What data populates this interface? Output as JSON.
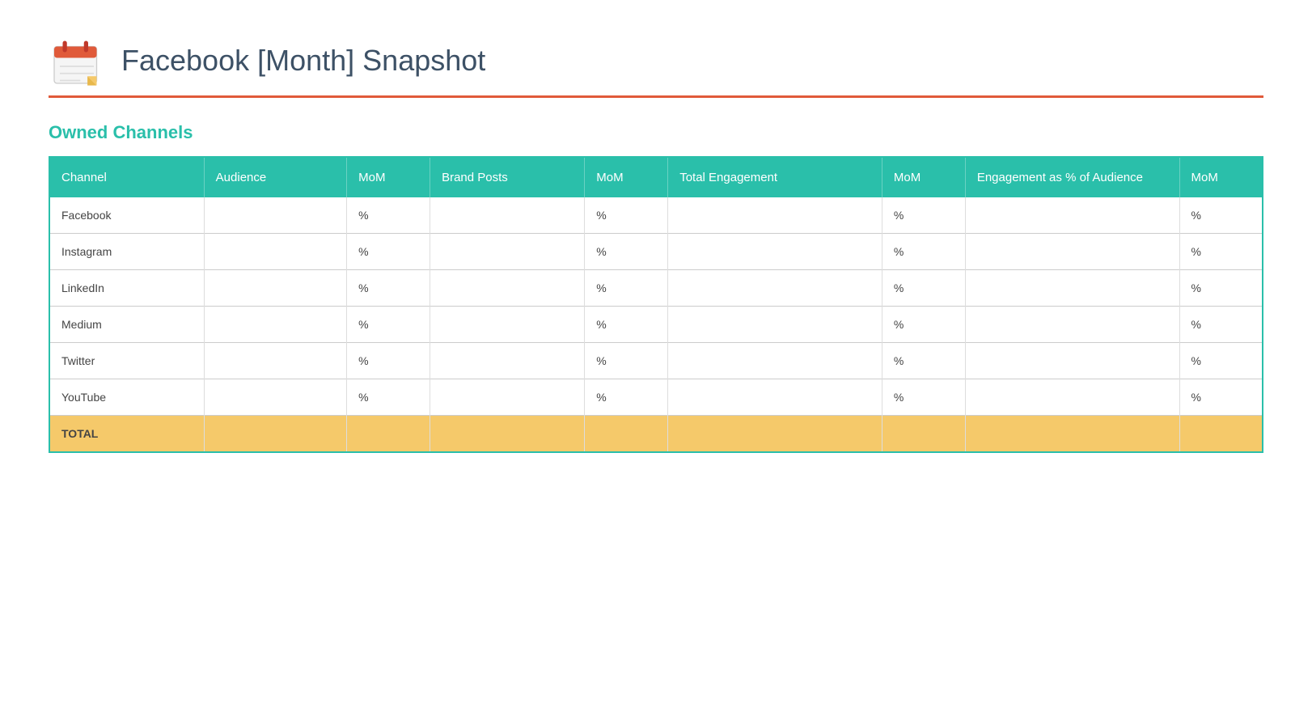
{
  "header": {
    "title": "Facebook [Month] Snapshot",
    "divider_color": "#e05a3a"
  },
  "section": {
    "owned_channels_label": "Owned Channels"
  },
  "table": {
    "columns": [
      {
        "label": "Channel",
        "key": "channel"
      },
      {
        "label": "Audience",
        "key": "audience"
      },
      {
        "label": "MoM",
        "key": "mom1"
      },
      {
        "label": "Brand Posts",
        "key": "brandPosts"
      },
      {
        "label": "MoM",
        "key": "mom2"
      },
      {
        "label": "Total Engagement",
        "key": "totalEngagement"
      },
      {
        "label": "MoM",
        "key": "mom3"
      },
      {
        "label": "Engagement as % of Audience",
        "key": "engPct"
      },
      {
        "label": "MoM",
        "key": "mom4"
      }
    ],
    "rows": [
      {
        "channel": "Facebook",
        "audience": "",
        "mom1": "%",
        "brandPosts": "",
        "mom2": "%",
        "totalEngagement": "",
        "mom3": "%",
        "engPct": "",
        "mom4": "%"
      },
      {
        "channel": "Instagram",
        "audience": "",
        "mom1": "%",
        "brandPosts": "",
        "mom2": "%",
        "totalEngagement": "",
        "mom3": "%",
        "engPct": "",
        "mom4": "%"
      },
      {
        "channel": "LinkedIn",
        "audience": "",
        "mom1": "%",
        "brandPosts": "",
        "mom2": "%",
        "totalEngagement": "",
        "mom3": "%",
        "engPct": "",
        "mom4": "%"
      },
      {
        "channel": "Medium",
        "audience": "",
        "mom1": "%",
        "brandPosts": "",
        "mom2": "%",
        "totalEngagement": "",
        "mom3": "%",
        "engPct": "",
        "mom4": "%"
      },
      {
        "channel": "Twitter",
        "audience": "",
        "mom1": "%",
        "brandPosts": "",
        "mom2": "%",
        "totalEngagement": "",
        "mom3": "%",
        "engPct": "",
        "mom4": "%"
      },
      {
        "channel": "YouTube",
        "audience": "",
        "mom1": "%",
        "brandPosts": "",
        "mom2": "%",
        "totalEngagement": "",
        "mom3": "%",
        "engPct": "",
        "mom4": "%"
      },
      {
        "channel": "TOTAL",
        "audience": "",
        "mom1": "",
        "brandPosts": "",
        "mom2": "",
        "totalEngagement": "",
        "mom3": "",
        "engPct": "",
        "mom4": ""
      }
    ],
    "total_row_label": "TOTAL"
  }
}
